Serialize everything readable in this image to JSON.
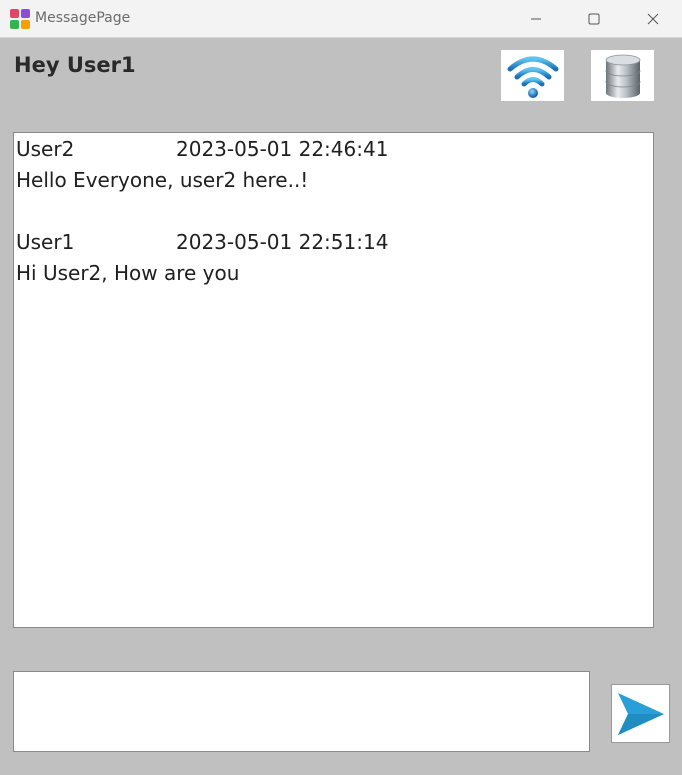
{
  "window": {
    "title": "MessagePage",
    "controls": [
      "minimize",
      "maximize",
      "close"
    ]
  },
  "header": {
    "greeting": "Hey User1",
    "icons": [
      "wifi-icon",
      "database-icon"
    ]
  },
  "messages": [
    {
      "user": "User2",
      "timestamp": "2023-05-01 22:46:41",
      "text": "Hello Everyone, user2 here..!"
    },
    {
      "user": "User1",
      "timestamp": "2023-05-01 22:51:14",
      "text": "Hi User2, How are you"
    }
  ],
  "compose": {
    "value": "",
    "placeholder": ""
  },
  "send": {
    "icon": "send-arrow-icon"
  },
  "colors": {
    "background": "#c0c0c0",
    "accent": "#2a9fd6",
    "titlebar": "#f3f3f3"
  }
}
